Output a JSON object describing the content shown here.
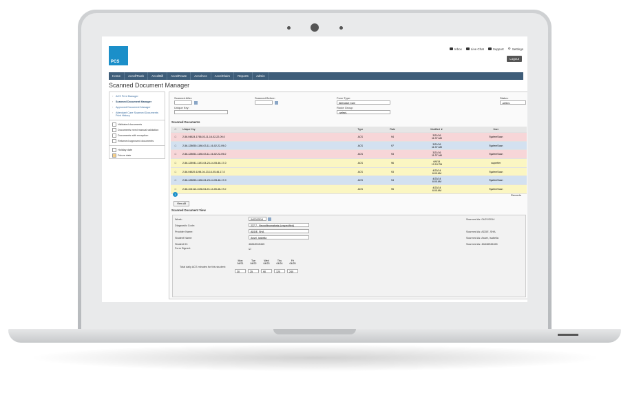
{
  "colors": {
    "nav": "#3e5d79",
    "brand": "#1b8fc9",
    "row_pink": "#f7d6d8",
    "row_blue": "#d3e1f0",
    "row_yellow": "#fbf6c2"
  },
  "logo": {
    "text": "PCS"
  },
  "toplinks": [
    {
      "icon": "mail-icon",
      "label": "Inbox"
    },
    {
      "icon": "chat-icon",
      "label": "Live Chat"
    },
    {
      "icon": "support-icon",
      "label": "Support"
    },
    {
      "icon": "gear-icon",
      "label": "Settings"
    }
  ],
  "logout": "Logout",
  "nav": [
    "Home",
    "AccellTrack",
    "AccelBill",
    "AccelRoute",
    "AccelAcs",
    "AccelClaim",
    "Reports",
    "Admin"
  ],
  "page_title": "Scanned Document Manager",
  "sidebar": {
    "links": [
      "ACS Print Manager",
      "Scanned Document Manager",
      "Approved Document Manager",
      "Attendant Care Scanned Documents Print History"
    ],
    "legend": [
      {
        "label": "Validated documents",
        "color": "#ffffff"
      },
      {
        "label": "Documents need manual validation",
        "color": "#ffffff"
      },
      {
        "label": "Documents with exception",
        "color": "#ffffff"
      },
      {
        "label": "Returned approved documents",
        "color": "#ffffff"
      },
      {
        "label": "Holiday date",
        "color": "#ffffff"
      },
      {
        "label": "Future date",
        "color": "#f6d08a"
      }
    ]
  },
  "filters": {
    "scanned_after": "Scanned After:",
    "scanned_before": "Scanned Before:",
    "form_type": "Form Type:",
    "form_type_value": "Attendant Care",
    "status": "Status:",
    "status_value": "-select-",
    "unique_key": "Unique Key:",
    "route_group": "Route Group:",
    "route_group_value": "-select-"
  },
  "scanned_docs": {
    "heading": "Scanned Documents",
    "columns": [
      "Unique Key",
      "Type",
      "Rate",
      "Modified ▼",
      "User"
    ],
    "rows": [
      {
        "key": "2-56-94824-1766-03-11-16-02-22-09-0",
        "type": "ACS",
        "rate": "94",
        "modified": "3/21/16\n11:37 AM",
        "user": "SystemScan",
        "color": "pink"
      },
      {
        "key": "2-56-128050-1198-03-11-16-02-22-09-0",
        "type": "ACS",
        "rate": "97",
        "modified": "3/21/16\n11:37 AM",
        "user": "SystemScan",
        "color": "blue"
      },
      {
        "key": "2-56-128051-1198-03-11-16-02-22-09-0",
        "type": "ACS",
        "rate": "93",
        "modified": "3/21/16\n11:37 AM",
        "user": "SystemScan",
        "color": "pink"
      },
      {
        "key": "2-56-128941-1193-04-23-14-05-46-17-0",
        "type": "ACS",
        "rate": "96",
        "modified": "6/6/14\n12:24 PM",
        "user": "superfier",
        "color": "yellow"
      },
      {
        "key": "2-56-94829-1198-04-23-14-05-46-17-0",
        "type": "ACS",
        "rate": "93",
        "modified": "4/23/14\n6:00 AM",
        "user": "SystemScan",
        "color": "yellow"
      },
      {
        "key": "2-56-128053-1198-04-23-14-05-46-17-0",
        "type": "ACS",
        "rate": "94",
        "modified": "4/23/14\n6:00 AM",
        "user": "SystemScan",
        "color": "blue"
      },
      {
        "key": "2-56-104113-1198-04-23-14-05-46-17-0",
        "type": "ACS",
        "rate": "95",
        "modified": "4/23/14\n6:00 AM",
        "user": "SystemScan",
        "color": "yellow"
      }
    ],
    "page": "1",
    "records": "Records"
  },
  "view_all": "View All",
  "doc_view": {
    "heading": "Scanned Document View",
    "week_label": "Week:",
    "week_value": "04/21/2014",
    "diag_label": "Diagnostic Code:",
    "diag_value": "237.7 - Neurofibromatosis (unspecified)",
    "provider_label": "Provider Name:",
    "provider_value": "ADDE, SHA",
    "student_label": "Student Name:",
    "student_value": "Assel, Isabella",
    "sid_label": "Student ID:",
    "sid_value": "46848945465",
    "signed_label": "Form Signed:",
    "right": [
      "Scanned As: 04/21/2014",
      "Scanned As: ADDE, SHA",
      "Scanned As: Asset, Isabella",
      "Scanned As: 46848945465"
    ],
    "total_label": "Total daily ACS minutes for this student:",
    "days": [
      {
        "d": "Mon",
        "date": "04/21",
        "val": "30"
      },
      {
        "d": "Tue",
        "date": "04/22",
        "val": "25"
      },
      {
        "d": "Wed",
        "date": "04/23",
        "val": "90"
      },
      {
        "d": "Thu",
        "date": "04/24",
        "val": "120"
      },
      {
        "d": "Fri",
        "date": "04/25",
        "val": "240"
      }
    ]
  }
}
